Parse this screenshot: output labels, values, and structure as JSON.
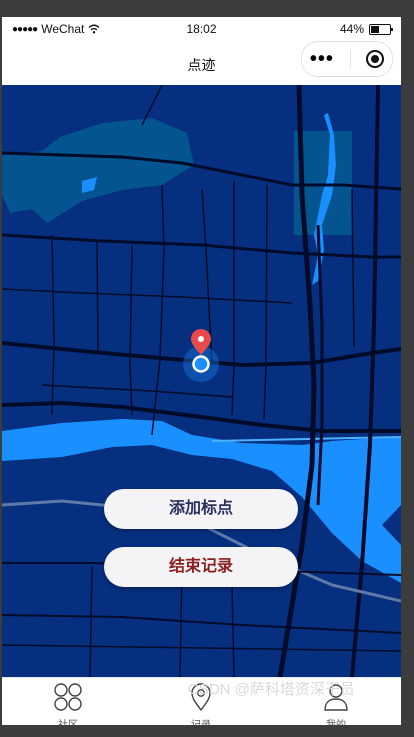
{
  "statusbar": {
    "carrier": "WeChat",
    "time": "18:02",
    "battery": "44%",
    "battery_level": 0.44
  },
  "navbar": {
    "title": "点迹"
  },
  "actions": {
    "add_marker": "添加标点",
    "end_record": "结束记录"
  },
  "colors": {
    "map_bg": "#062f80",
    "water": "#1a8fff",
    "pin": "#e84a4a",
    "add_text": "#2a2f5e",
    "end_text": "#8b2020"
  },
  "tabs": [
    {
      "label": "社区",
      "icon": "grid-icon",
      "active": false
    },
    {
      "label": "记录",
      "icon": "location-pin-icon",
      "active": true
    },
    {
      "label": "我的",
      "icon": "user-icon",
      "active": false
    }
  ],
  "watermark": "CSDN @萨科塔资深干员"
}
